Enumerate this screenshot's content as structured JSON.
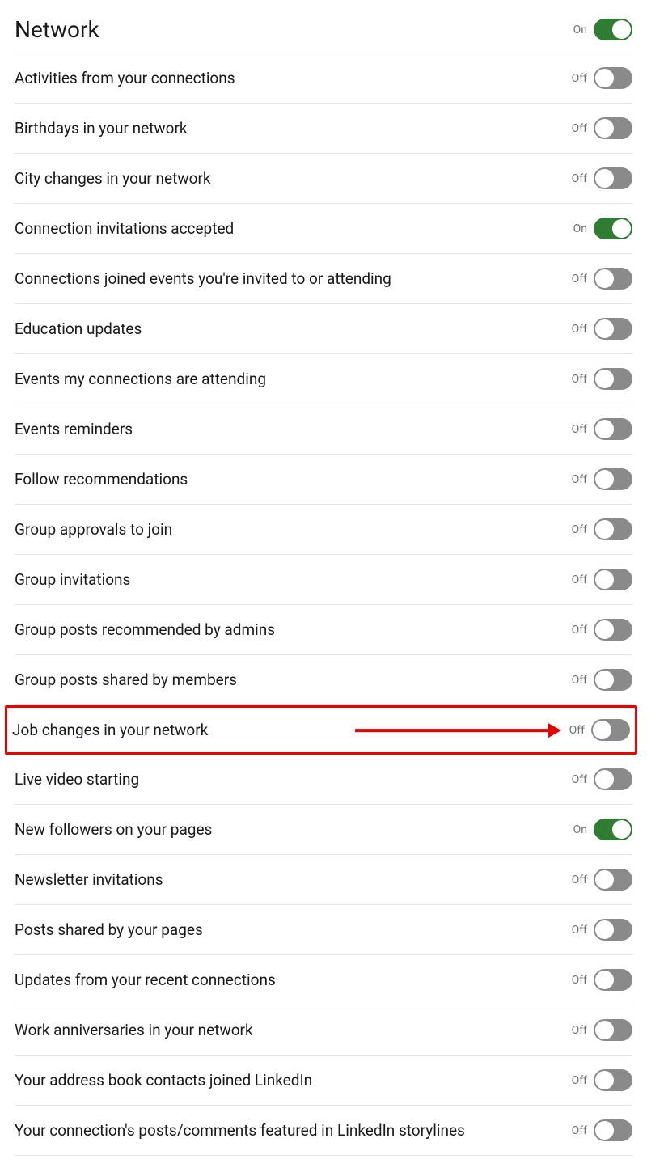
{
  "header": {
    "title": "Network",
    "state": "on",
    "state_label": "On"
  },
  "labels": {
    "on": "On",
    "off": "Off"
  },
  "settings": [
    {
      "id": "activities-connections",
      "label": "Activities from your connections",
      "state": "off"
    },
    {
      "id": "birthdays",
      "label": "Birthdays in your network",
      "state": "off"
    },
    {
      "id": "city-changes",
      "label": "City changes in your network",
      "state": "off"
    },
    {
      "id": "connection-invitations-accepted",
      "label": "Connection invitations accepted",
      "state": "on"
    },
    {
      "id": "connections-joined-events",
      "label": "Connections joined events you're invited to or attending",
      "state": "off"
    },
    {
      "id": "education-updates",
      "label": "Education updates",
      "state": "off"
    },
    {
      "id": "events-connections-attending",
      "label": "Events my connections are attending",
      "state": "off"
    },
    {
      "id": "events-reminders",
      "label": "Events reminders",
      "state": "off"
    },
    {
      "id": "follow-recommendations",
      "label": "Follow recommendations",
      "state": "off"
    },
    {
      "id": "group-approvals",
      "label": "Group approvals to join",
      "state": "off"
    },
    {
      "id": "group-invitations",
      "label": "Group invitations",
      "state": "off"
    },
    {
      "id": "group-posts-admins",
      "label": "Group posts recommended by admins",
      "state": "off"
    },
    {
      "id": "group-posts-members",
      "label": "Group posts shared by members",
      "state": "off"
    },
    {
      "id": "job-changes",
      "label": "Job changes in your network",
      "state": "off",
      "highlight": true
    },
    {
      "id": "live-video",
      "label": "Live video starting",
      "state": "off"
    },
    {
      "id": "new-followers-pages",
      "label": "New followers on your pages",
      "state": "on"
    },
    {
      "id": "newsletter-invitations",
      "label": "Newsletter invitations",
      "state": "off"
    },
    {
      "id": "posts-shared-pages",
      "label": "Posts shared by your pages",
      "state": "off"
    },
    {
      "id": "updates-recent-connections",
      "label": "Updates from your recent connections",
      "state": "off"
    },
    {
      "id": "work-anniversaries",
      "label": "Work anniversaries in your network",
      "state": "off"
    },
    {
      "id": "address-book-joined",
      "label": "Your address book contacts joined LinkedIn",
      "state": "off"
    },
    {
      "id": "connection-posts-storylines",
      "label": "Your connection's posts/comments featured in LinkedIn storylines",
      "state": "off"
    }
  ],
  "colors": {
    "toggle_on": "#2f7d32",
    "toggle_off": "#8a8a8a",
    "highlight": "#e60000"
  }
}
